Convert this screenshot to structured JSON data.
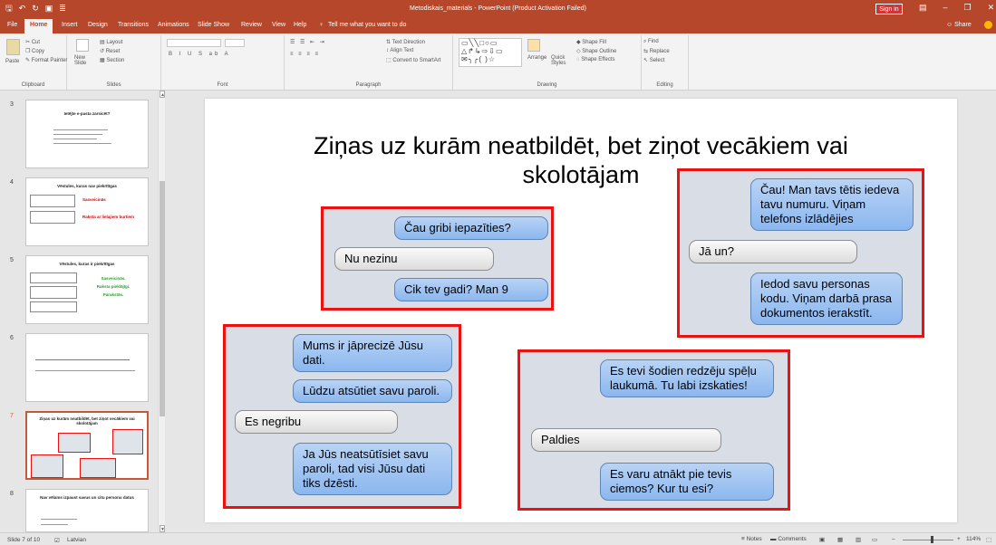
{
  "window": {
    "title": "Metodiskais_materials  -  PowerPoint (Product Activation Failed)",
    "sign_in": "Sign in",
    "share": "Share"
  },
  "tabs": [
    "File",
    "Home",
    "Insert",
    "Design",
    "Transitions",
    "Animations",
    "Slide Show",
    "Review",
    "View",
    "Help"
  ],
  "tell_me": "Tell me what you want to do",
  "ribbon": {
    "clipboard": {
      "label": "Clipboard",
      "paste": "Paste",
      "cut": "Cut",
      "copy": "Copy",
      "format_painter": "Format Painter"
    },
    "slides": {
      "label": "Slides",
      "new_slide": "New Slide",
      "layout": "Layout",
      "reset": "Reset",
      "section": "Section"
    },
    "font": {
      "label": "Font"
    },
    "paragraph": {
      "label": "Paragraph",
      "text_direction": "Text Direction",
      "align_text": "Align Text",
      "smartart": "Convert to SmartArt"
    },
    "drawing": {
      "label": "Drawing",
      "arrange": "Arrange",
      "quick_styles": "Quick Styles",
      "shape_fill": "Shape Fill",
      "shape_outline": "Shape Outline",
      "shape_effects": "Shape Effects"
    },
    "editing": {
      "label": "Editing",
      "find": "Find",
      "replace": "Replace",
      "select": "Select"
    }
  },
  "thumbnails": [
    {
      "num": "3",
      "title": "Ietējte e-pasta zarsicēt?"
    },
    {
      "num": "4",
      "title": "Vēstules, kuras nav piekrītīgas",
      "l1": "Sasveicinās",
      "l2": "Raksta ar lielajiem burtiem"
    },
    {
      "num": "5",
      "title": "Vēstules, kuras ir piekrītīgas",
      "l1": "Sasveicinās.",
      "l2": "Raksta pieklājīgi.",
      "l3": "Parakstās."
    },
    {
      "num": "6",
      "title": ""
    },
    {
      "num": "7",
      "title": "Ziņas uz kurām neatbildēt, bet ziņot vecākiem vai skolotājam"
    },
    {
      "num": "8",
      "title": "Nav vēlams izpaust savus un citu personu datus"
    }
  ],
  "slide": {
    "title": "Ziņas uz kurām neatbildēt, bet ziņot vecākiem vai skolotājam",
    "chats": [
      {
        "messages": [
          "Čau gribi iepazīties?",
          "Nu nezinu",
          "Cik tev gadi? Man 9"
        ]
      },
      {
        "messages": [
          "Čau! Man tavs tētis iedeva tavu numuru. Viņam telefons izlādējies",
          "Jā un?",
          "Iedod savu personas kodu. Viņam darbā prasa dokumentos ierakstīt."
        ]
      },
      {
        "messages": [
          "Mums ir jāprecizē Jūsu dati.",
          "Lūdzu atsūtiet savu paroli.",
          "Es negribu",
          "Ja Jūs neatsūtīsiet savu paroli, tad visi Jūsu dati tiks dzēsti."
        ]
      },
      {
        "messages": [
          "Es tevi šodien redzēju spēļu laukumā. Tu labi izskaties!",
          "Paldies",
          "Es varu atnākt pie tevis ciemos? Kur tu esi?"
        ]
      }
    ]
  },
  "status": {
    "slide_info": "Slide 7 of 10",
    "language": "Latvian",
    "notes": "Notes",
    "comments": "Comments",
    "zoom": "114%"
  }
}
